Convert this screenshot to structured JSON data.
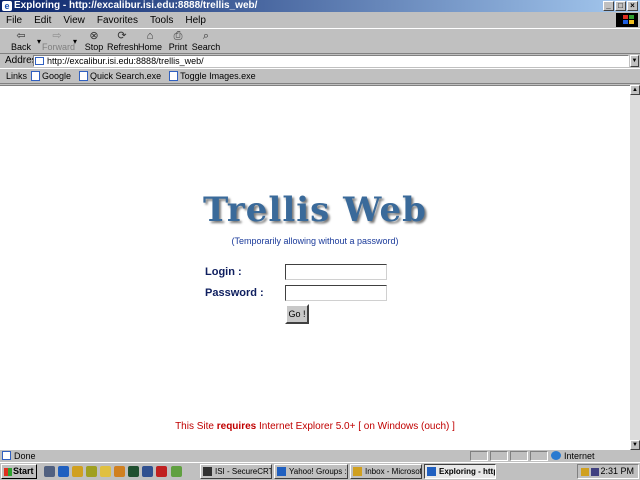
{
  "window": {
    "title": "Exploring - http://excalibur.isi.edu:8888/trellis_web/",
    "controls": [
      "_",
      "□",
      "×"
    ]
  },
  "menu": [
    "File",
    "Edit",
    "View",
    "Favorites",
    "Tools",
    "Help"
  ],
  "toolbar": [
    {
      "label": "Back",
      "icon": "back-arrow-icon",
      "glyph": "⇦",
      "enabled": true
    },
    {
      "label": "Forward",
      "icon": "forward-arrow-icon",
      "glyph": "⇨",
      "enabled": false
    },
    {
      "label": "Stop",
      "icon": "stop-icon",
      "glyph": "⊗",
      "enabled": true
    },
    {
      "label": "Refresh",
      "icon": "refresh-icon",
      "glyph": "⟳",
      "enabled": true
    },
    {
      "label": "Home",
      "icon": "home-icon",
      "glyph": "⌂",
      "enabled": true
    },
    {
      "label": "Print",
      "icon": "print-icon",
      "glyph": "⎙",
      "enabled": true
    },
    {
      "label": "Search",
      "icon": "search-icon",
      "glyph": "⌕",
      "enabled": true
    }
  ],
  "address": {
    "label": "Address",
    "url": "http://excalibur.isi.edu:8888/trellis_web/"
  },
  "links": {
    "label": "Links",
    "items": [
      "Google",
      "Quick Search.exe",
      "Toggle Images.exe"
    ]
  },
  "page": {
    "logo": "Trellis Web",
    "subtitle": "(Temporarily allowing without a password)",
    "login_label": "Login :",
    "password_label": "Password :",
    "login_value": "",
    "password_value": "",
    "go_label": "Go !",
    "footer_pre": "This Site ",
    "footer_bold": "requires",
    "footer_post": " Internet Explorer 5.0+ [ on Windows (ouch) ]"
  },
  "status": {
    "text": "Done",
    "zone": "Internet"
  },
  "taskbar": {
    "start": "Start",
    "tasks": [
      {
        "label": "ISI - SecureCRT",
        "active": false
      },
      {
        "label": "Yahoo! Groups : i...",
        "active": false
      },
      {
        "label": "Inbox - Microsoft ...",
        "active": false
      },
      {
        "label": "Exploring - http...",
        "active": true
      }
    ],
    "clock": "2:31 PM"
  },
  "colors": {
    "titlebar": "#0a246a",
    "logo": "#3a6a9a",
    "footer": "#c00000",
    "labels": "#102060"
  }
}
